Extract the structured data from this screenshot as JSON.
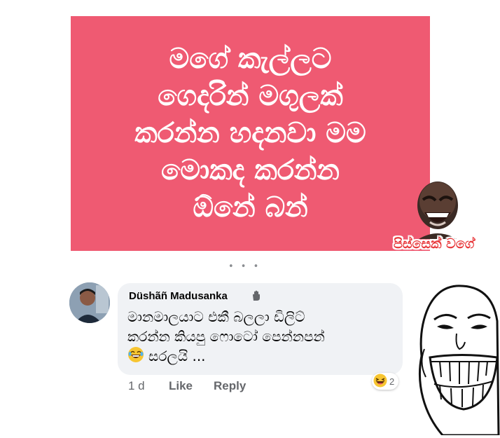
{
  "post": {
    "lines": [
      "මගේ කැල්ලට",
      "ගෙදරින් මගුලක්",
      "කරන්න හදනවා මම",
      "මොකද කරන්න",
      "ඕනේ බන්"
    ],
    "background_color": "#ef5a72",
    "text_color": "#ffffff"
  },
  "meme_sticker": {
    "caption": "පිස්සෙක් වගේ",
    "icon": "laughing-man-icon"
  },
  "comment": {
    "author": "Düshãñ Madusanka",
    "author_badge_icon": "wave-hand-icon",
    "lines": [
      "මානමාලයාට එකී බලලා ඩිලිට්",
      "කරන්න කියපු ෆොටෝ පෙන්නපන්"
    ],
    "last_line_text": "සරලයි ...",
    "emoji_icon": "laughing-emoji-icon",
    "time": "1 d",
    "like_label": "Like",
    "reply_label": "Reply",
    "reaction_icon": "haha-reaction-icon",
    "reaction_count": "2"
  },
  "troll_face_icon": "troll-face-icon"
}
